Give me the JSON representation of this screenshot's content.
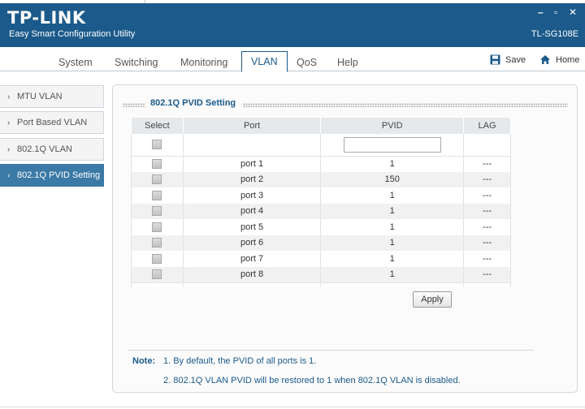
{
  "window": {
    "logo": "TP-LINK",
    "subtitle": "Easy Smart Configuration Utility",
    "model": "TL-SG108E",
    "minimize_glyph": "–",
    "maximize_glyph": "▫",
    "close_glyph": "✕"
  },
  "nav": {
    "tabs": [
      {
        "label": "System"
      },
      {
        "label": "Switching"
      },
      {
        "label": "Monitoring"
      },
      {
        "label": "VLAN"
      },
      {
        "label": "QoS"
      },
      {
        "label": "Help"
      }
    ],
    "active_tab": "VLAN",
    "save_label": "Save",
    "home_label": "Home"
  },
  "sidebar": {
    "items": [
      {
        "label": "MTU VLAN"
      },
      {
        "label": "Port Based VLAN"
      },
      {
        "label": "802.1Q VLAN"
      },
      {
        "label": "802.1Q PVID Setting"
      }
    ],
    "active_item": "802.1Q PVID Setting"
  },
  "panel": {
    "title": "802.1Q PVID Setting",
    "columns": {
      "select": "Select",
      "port": "Port",
      "pvid": "PVID",
      "lag": "LAG"
    },
    "pvid_input_value": "",
    "rows": [
      {
        "port": "port 1",
        "pvid": "1",
        "lag": "---"
      },
      {
        "port": "port 2",
        "pvid": "150",
        "lag": "---"
      },
      {
        "port": "port 3",
        "pvid": "1",
        "lag": "---"
      },
      {
        "port": "port 4",
        "pvid": "1",
        "lag": "---"
      },
      {
        "port": "port 5",
        "pvid": "1",
        "lag": "---"
      },
      {
        "port": "port 6",
        "pvid": "1",
        "lag": "---"
      },
      {
        "port": "port 7",
        "pvid": "1",
        "lag": "---"
      },
      {
        "port": "port 8",
        "pvid": "1",
        "lag": "---"
      }
    ],
    "apply_label": "Apply",
    "note": {
      "label": "Note:",
      "lines": [
        "1. By default, the PVID of all ports is 1.",
        "2. 802.1Q VLAN PVID will be restored to 1 when 802.1Q VLAN is disabled."
      ]
    }
  },
  "colors": {
    "brand": "#1b5a8a",
    "sidebar_active": "#3b79a6",
    "header_bg": "#e6e9ec"
  },
  "icons": {
    "save": "floppy-disk-icon",
    "home": "house-icon",
    "sidebar_bullet": "chevron-right-icon",
    "select_all": "checkbox-icon"
  }
}
